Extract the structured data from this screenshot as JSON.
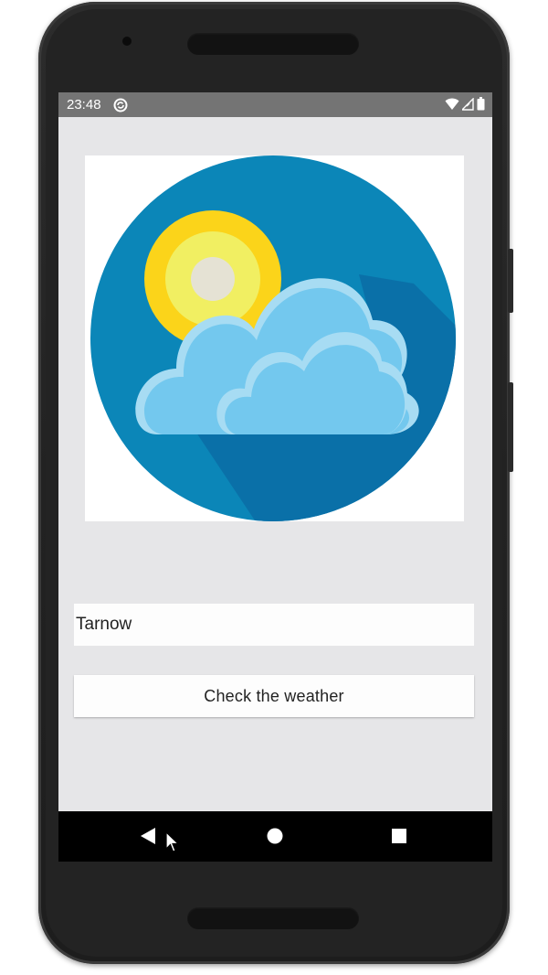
{
  "status_bar": {
    "time": "23:48",
    "icons": [
      "notification-sync-icon",
      "wifi-icon",
      "signal-icon",
      "battery-icon"
    ]
  },
  "app": {
    "image": {
      "icon": "weather-cloud-sun-icon",
      "colors": {
        "circle": "#0b86b8",
        "shadow": "#0a70a8",
        "sun_outer": "#fbd41a",
        "sun_inner": "#f1ef62",
        "sun_core": "#e5e2d4",
        "cloud": "#73c8ee",
        "cloud_highlight": "#a7dcf3"
      }
    },
    "city_input": {
      "value": "Tarnow"
    },
    "check_button": {
      "label": "Check the weather"
    }
  },
  "nav_bar": {
    "buttons": [
      "back-icon",
      "home-icon",
      "recents-icon"
    ]
  }
}
